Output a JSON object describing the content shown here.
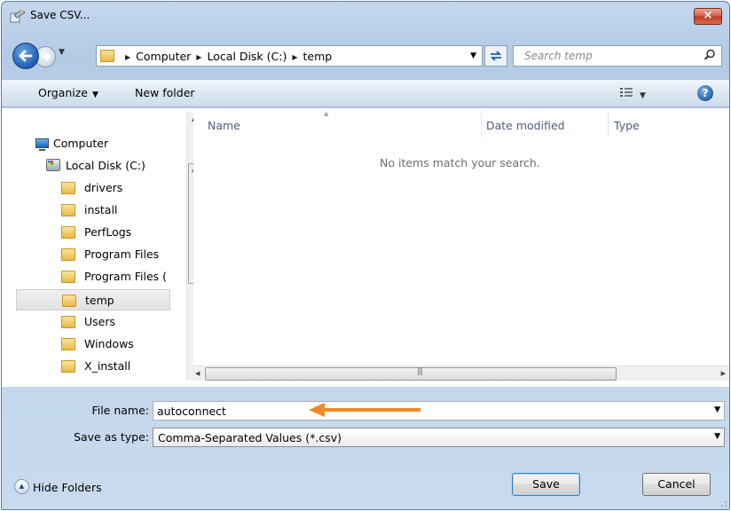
{
  "window": {
    "title": "Save CSV...",
    "close_label": "×"
  },
  "address": {
    "crumbs": [
      "Computer",
      "Local Disk (C:)",
      "temp"
    ],
    "separator": "▶"
  },
  "search": {
    "placeholder": "Search temp"
  },
  "toolbar": {
    "organize_label": "Organize",
    "new_folder_label": "New folder",
    "help_label": "?"
  },
  "nav": {
    "items": [
      {
        "label": "Computer",
        "icon": "computer-icon"
      },
      {
        "label": "Local Disk (C:)",
        "icon": "disk-icon"
      },
      {
        "label": "drivers",
        "icon": "folder-icon"
      },
      {
        "label": "install",
        "icon": "folder-icon"
      },
      {
        "label": "PerfLogs",
        "icon": "folder-icon"
      },
      {
        "label": "Program Files",
        "icon": "folder-icon"
      },
      {
        "label": "Program Files (",
        "icon": "folder-icon"
      },
      {
        "label": "temp",
        "icon": "folder-icon",
        "selected": true
      },
      {
        "label": "Users",
        "icon": "folder-icon"
      },
      {
        "label": "Windows",
        "icon": "folder-icon"
      },
      {
        "label": "X_install",
        "icon": "folder-icon"
      }
    ]
  },
  "filelist": {
    "columns": [
      "Name",
      "Date modified",
      "Type"
    ],
    "empty_message": "No items match your search."
  },
  "form": {
    "filename_label": "File name:",
    "filename_value": "autoconnect",
    "savetype_label": "Save as type:",
    "savetype_value": "Comma-Separated Values (*.csv)"
  },
  "buttons": {
    "save": "Save",
    "cancel": "Cancel",
    "hide_folders": "Hide Folders"
  },
  "colors": {
    "annotation_arrow": "#f08a24",
    "titlebar": "#c4d7ed",
    "close_button": "#c03b22"
  }
}
